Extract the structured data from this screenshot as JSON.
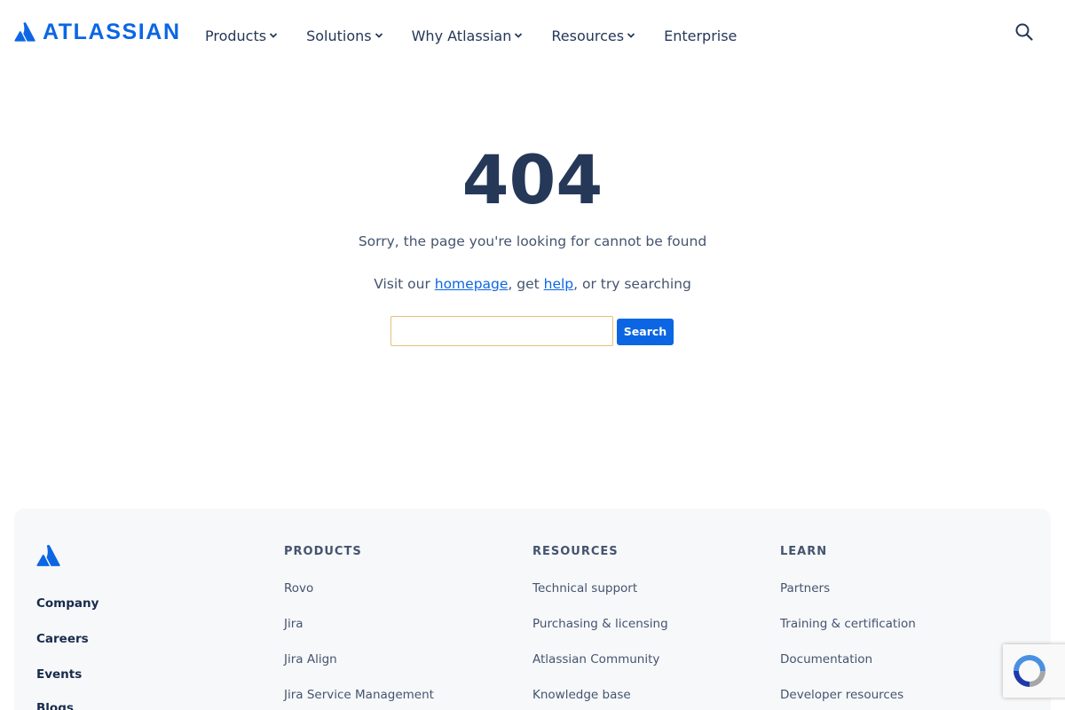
{
  "header": {
    "logo_text": "ATLASSIAN",
    "nav": [
      {
        "label": "Products",
        "has_dropdown": true
      },
      {
        "label": "Solutions",
        "has_dropdown": true
      },
      {
        "label": "Why Atlassian",
        "has_dropdown": true
      },
      {
        "label": "Resources",
        "has_dropdown": true
      },
      {
        "label": "Enterprise",
        "has_dropdown": false
      }
    ],
    "search_icon": "search-icon"
  },
  "main": {
    "code": "404",
    "message": "Sorry, the page you're looking for cannot be found",
    "visit_prefix": "Visit our ",
    "homepage_link": "homepage",
    "visit_mid": ", get ",
    "help_link": "help",
    "visit_suffix": ", or try searching",
    "search_value": "",
    "search_button": "Search"
  },
  "footer": {
    "logo_icon": "atlassian-icon",
    "company_links": [
      "Company",
      "Careers",
      "Events",
      "Blogs"
    ],
    "columns": [
      {
        "title": "PRODUCTS",
        "links": [
          "Rovo",
          "Jira",
          "Jira Align",
          "Jira Service Management"
        ]
      },
      {
        "title": "RESOURCES",
        "links": [
          "Technical support",
          "Purchasing & licensing",
          "Atlassian Community",
          "Knowledge base"
        ]
      },
      {
        "title": "LEARN",
        "links": [
          "Partners",
          "Training & certification",
          "Documentation",
          "Developer resources"
        ]
      }
    ]
  },
  "colors": {
    "brand_blue": "#0c66e4",
    "heading": "#253858",
    "text_muted": "#44546f",
    "footer_bg": "#f7f8f9"
  }
}
